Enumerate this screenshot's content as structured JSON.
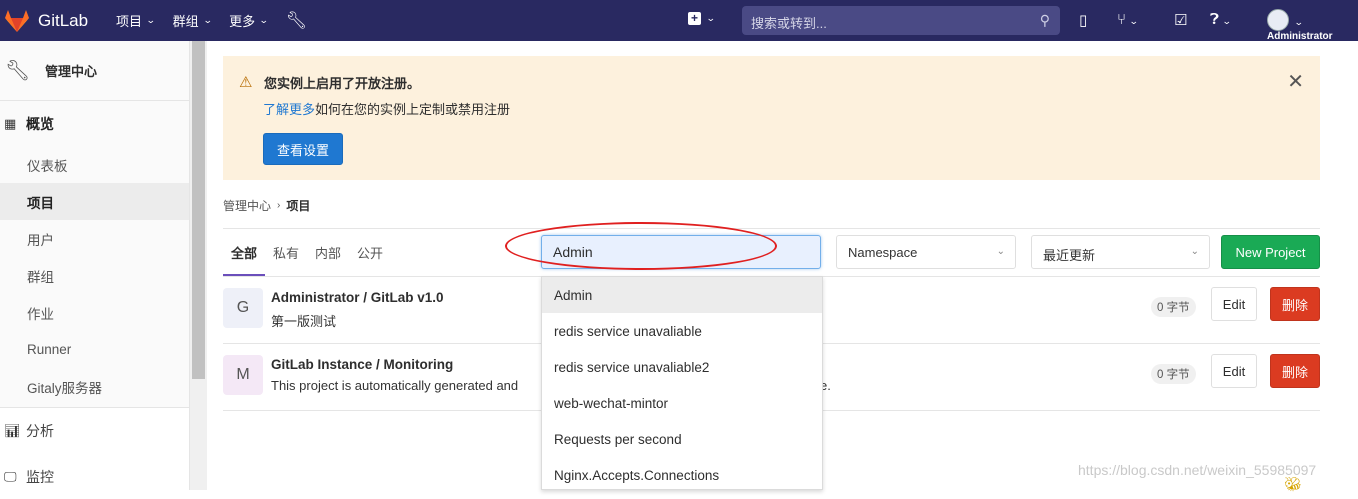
{
  "topbar": {
    "app_name": "GitLab",
    "menu": [
      "项目",
      "群组",
      "更多"
    ],
    "search_placeholder": "搜索或转到...",
    "user": "Administrator"
  },
  "sidebar": {
    "header": "管理中心",
    "overview": "概览",
    "items": [
      "仪表板",
      "项目",
      "用户",
      "群组",
      "作业",
      "Runner",
      "Gitaly服务器"
    ],
    "analytics": "分析",
    "monitoring": "监控"
  },
  "alert": {
    "title": "您实例上启用了开放注册。",
    "link": "了解更多",
    "text": "如何在您的实例上定制或禁用注册",
    "button": "查看设置"
  },
  "breadcrumb": {
    "parent": "管理中心",
    "current": "项目"
  },
  "tabs": [
    "全部",
    "私有",
    "内部",
    "公开"
  ],
  "filter": {
    "value": "Admin"
  },
  "namespace_select": "Namespace",
  "sort_select": "最近更新",
  "new_project": "New Project",
  "projects": [
    {
      "letter": "G",
      "name": "Administrator / GitLab v1.0",
      "desc": "第一版测试",
      "size": "0 字节",
      "edit": "Edit",
      "delete": "删除"
    },
    {
      "letter": "M",
      "name": "GitLab Instance / Monitoring",
      "desc": "This project is automatically generated and",
      "desc_tail": "e.",
      "size": "0 字节",
      "edit": "Edit",
      "delete": "删除"
    }
  ],
  "autocomplete": [
    "Admin",
    "redis service unavaliable",
    "redis service unavaliable2",
    "web-wechat-mintor",
    "Requests per second",
    "Nginx.Accepts.Connections"
  ],
  "watermark": "https://blog.csdn.net/weixin_55985097",
  "colors": {
    "topbar": "#292961",
    "primary": "#1f78d1",
    "success": "#1aaa55",
    "danger": "#db3b21",
    "alert_bg": "#fdf1dd",
    "annotation": "#e02020"
  }
}
